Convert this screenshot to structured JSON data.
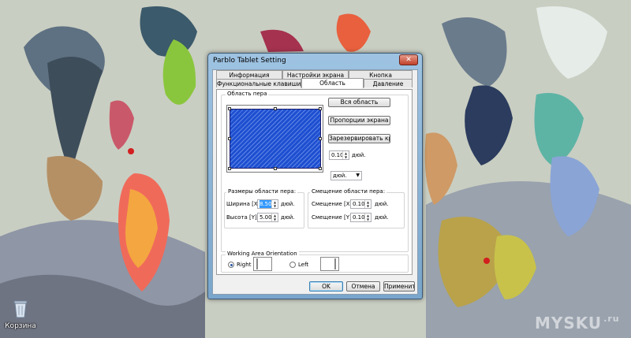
{
  "desktop": {
    "recycle_bin_label": "Корзина",
    "watermark": "MYSKU",
    "watermark_suffix": ".ru"
  },
  "window": {
    "title": "Parblo Tablet Setting",
    "close_glyph": "✕"
  },
  "tabs": [
    {
      "label": "Информация"
    },
    {
      "label": "Настройки экрана"
    },
    {
      "label": "Кнопка"
    },
    {
      "label": "Функциональные клавиши"
    },
    {
      "label": "Область",
      "active": true
    },
    {
      "label": "Давление"
    }
  ],
  "pen_area": {
    "legend": "Область пера",
    "buttons": {
      "full_area": "Вся область",
      "screen_proportion": "Пропорции экрана",
      "reserve_edges": "Зарезервировать края"
    },
    "margin_value": "0.10",
    "margin_unit": "дюй.",
    "unit_select": "дюй."
  },
  "size_group": {
    "legend": "Размеры области пера:",
    "width_label": "Ширина [X]:",
    "width_value": "8.50",
    "height_label": "Высота [Y]:",
    "height_value": "5.00",
    "unit": "дюй."
  },
  "offset_group": {
    "legend": "Смещение области пера:",
    "x_label": "Смещение [X]:",
    "x_value": "0.10",
    "y_label": "Смещение [Y]:",
    "y_value": "0.10",
    "unit": "дюй."
  },
  "orientation": {
    "legend": "Working Area Orientation",
    "right_label": "Right",
    "left_label": "Left",
    "selected": "right"
  },
  "footer": {
    "ok": "OK",
    "cancel": "Отмена",
    "apply": "Применить"
  },
  "colors": {
    "selection_blue": "#1e4fd0",
    "window_frame": "#9ec3e2"
  }
}
